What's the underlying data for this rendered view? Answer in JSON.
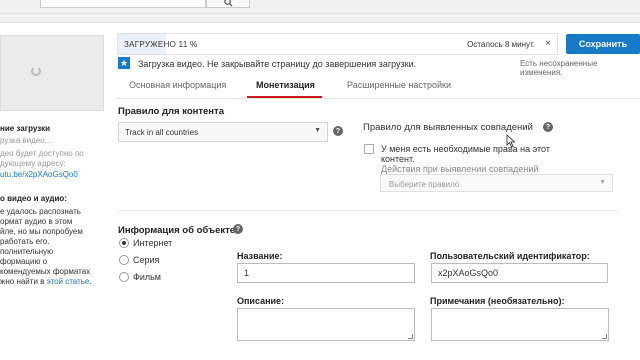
{
  "topbar": {
    "search_icon": "search-icon"
  },
  "upload": {
    "progress_label": "ЗАГРУЖЕНО 11 %",
    "progress_percent": 11,
    "remaining": "Осталось 8 минут.",
    "close": "×",
    "notice": "Загрузка видео. Не закрывайте страницу до завершения загрузки.",
    "notice_icon": "star-icon",
    "accent_color": "#167ac6"
  },
  "actions": {
    "save_label": "Сохранить",
    "unsaved": "Есть несохраненные изменения."
  },
  "tabs": [
    {
      "label": "Основная информация"
    },
    {
      "label": "Монетизация",
      "active": true
    },
    {
      "label": "Расширенные настройки"
    }
  ],
  "sidebar": {
    "l1": "ние загрузки",
    "l2": "рузка видео...",
    "l3": "део будет доступно по",
    "l4": "дующему адресу:",
    "link": "utu.be/x2pXAoGsQo0",
    "h2": "о видео и аудио:",
    "p1": "е удалось распознать",
    "p2": "ормат аудио в этом",
    "p3": "йле, но мы попробуем",
    "p4": "работать его.",
    "p5": "полнительную",
    "p6": "формацию о",
    "p7": "комендуемых форматах",
    "p8": "жно найти в ",
    "p8_link": "этой статье",
    "p8_end": "."
  },
  "content_rule": {
    "title": "Правило для контента",
    "value": "Track in all countries"
  },
  "match_rule": {
    "title": "Правило для выявленных совпадений",
    "checkbox_label_1": "У меня есть необходимые права на этот",
    "checkbox_label_2": "контент.",
    "action_label": "Действия при выявлении совпадений",
    "action_placeholder": "Выберите правило"
  },
  "asset": {
    "title": "Информация об объекте",
    "types": [
      {
        "label": "Интернет",
        "selected": true
      },
      {
        "label": "Серия",
        "selected": false
      },
      {
        "label": "Фильм",
        "selected": false
      }
    ],
    "name_label": "Название:",
    "name_value": "1",
    "custom_id_label": "Пользовательский идентификатор:",
    "custom_id_value": "x2pXAoGsQo0",
    "description_label": "Описание:",
    "notes_label": "Примечания (необязательно):"
  }
}
